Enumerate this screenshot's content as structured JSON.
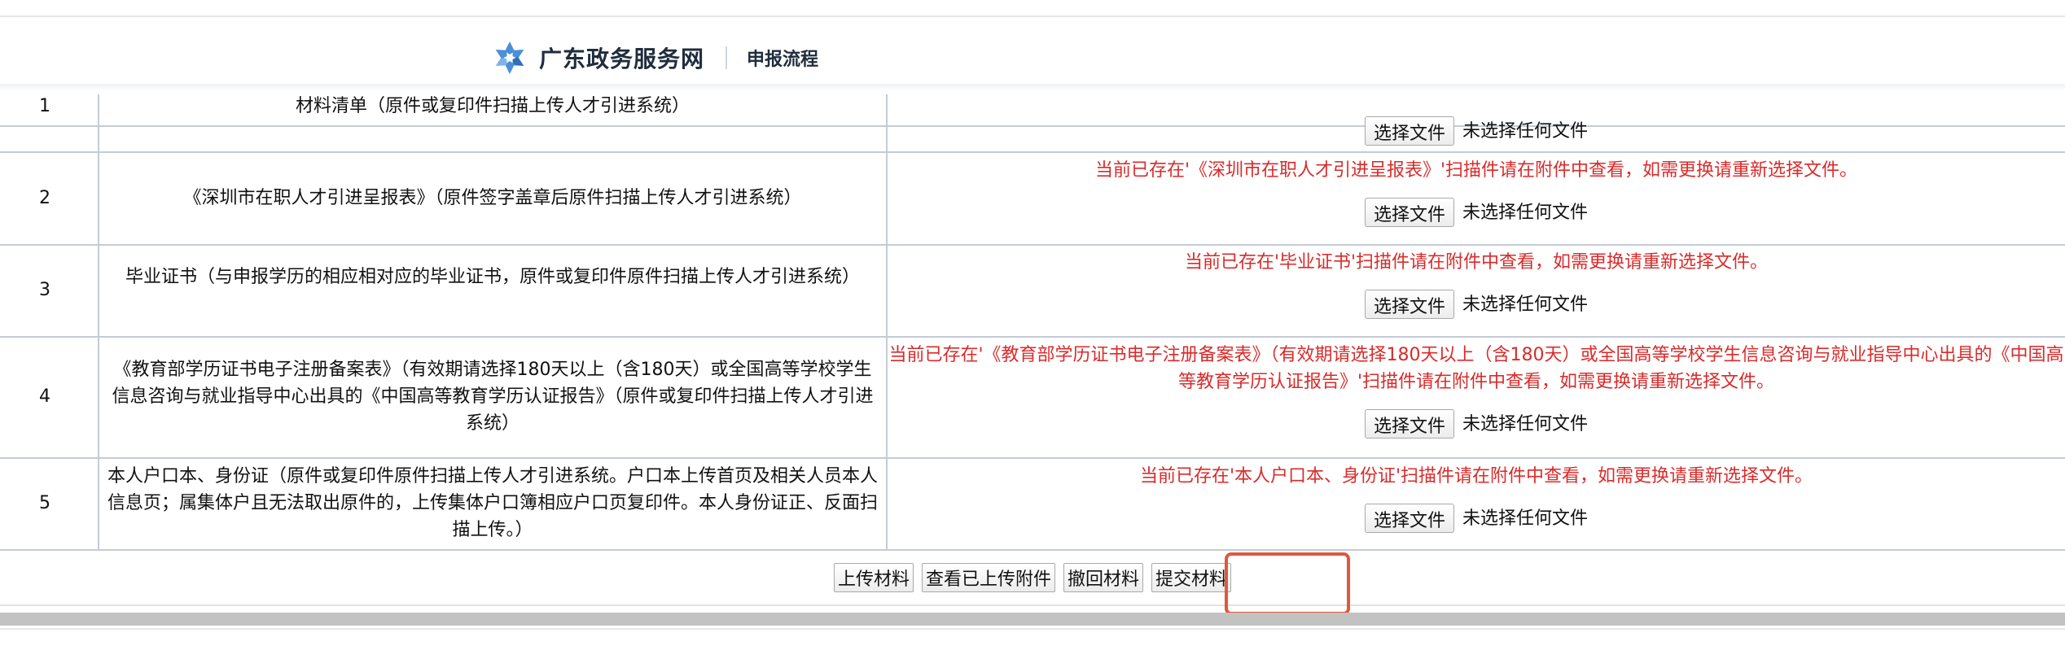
{
  "header": {
    "site_name": "广东政务服务网",
    "page_name": "申报流程",
    "logo_icon": "snowflake-logo-icon",
    "logo_color": "#4a90d9"
  },
  "materials": [
    {
      "num": "1",
      "name": "材料清单（原件或复印件扫描上传人才引进系统）",
      "notice": "",
      "file_button": "选择文件",
      "file_status": "未选择任何文件"
    },
    {
      "num": "2",
      "name": "《深圳市在职人才引进呈报表》（原件签字盖章后原件扫描上传人才引进系统）",
      "notice": "当前已存在'《深圳市在职人才引进呈报表》'扫描件请在附件中查看，如需更换请重新选择文件。",
      "file_button": "选择文件",
      "file_status": "未选择任何文件"
    },
    {
      "num": "3",
      "name": "毕业证书（与申报学历的相应相对应的毕业证书，原件或复印件原件扫描上传人才引进系统）",
      "notice": "当前已存在'毕业证书'扫描件请在附件中查看，如需更换请重新选择文件。",
      "file_button": "选择文件",
      "file_status": "未选择任何文件"
    },
    {
      "num": "4",
      "name": "《教育部学历证书电子注册备案表》（有效期请选择180天以上（含180天）或全国高等学校学生信息咨询与就业指导中心出具的《中国高等教育学历认证报告》（原件或复印件扫描上传人才引进系统）",
      "notice": "当前已存在'《教育部学历证书电子注册备案表》（有效期请选择180天以上（含180天）或全国高等学校学生信息咨询与就业指导中心出具的《中国高等教育学历认证报告》'扫描件请在附件中查看，如需更换请重新选择文件。",
      "file_button": "选择文件",
      "file_status": "未选择任何文件"
    },
    {
      "num": "5",
      "name": "本人户口本、身份证（原件或复印件原件扫描上传人才引进系统。户口本上传首页及相关人员本人信息页；属集体户且无法取出原件的，上传集体户口簿相应户口页复印件。本人身份证正、反面扫描上传。）",
      "notice": "当前已存在'本人户口本、身份证'扫描件请在附件中查看，如需更换请重新选择文件。",
      "file_button": "选择文件",
      "file_status": "未选择任何文件"
    }
  ],
  "actions": {
    "upload": "上传材料",
    "view_uploaded": "查看已上传附件",
    "withdraw": "撤回材料",
    "submit": "提交材料"
  },
  "colors": {
    "notice": "#d92b2b",
    "highlight": "#e0583c",
    "grid": "#c5cbd6"
  }
}
